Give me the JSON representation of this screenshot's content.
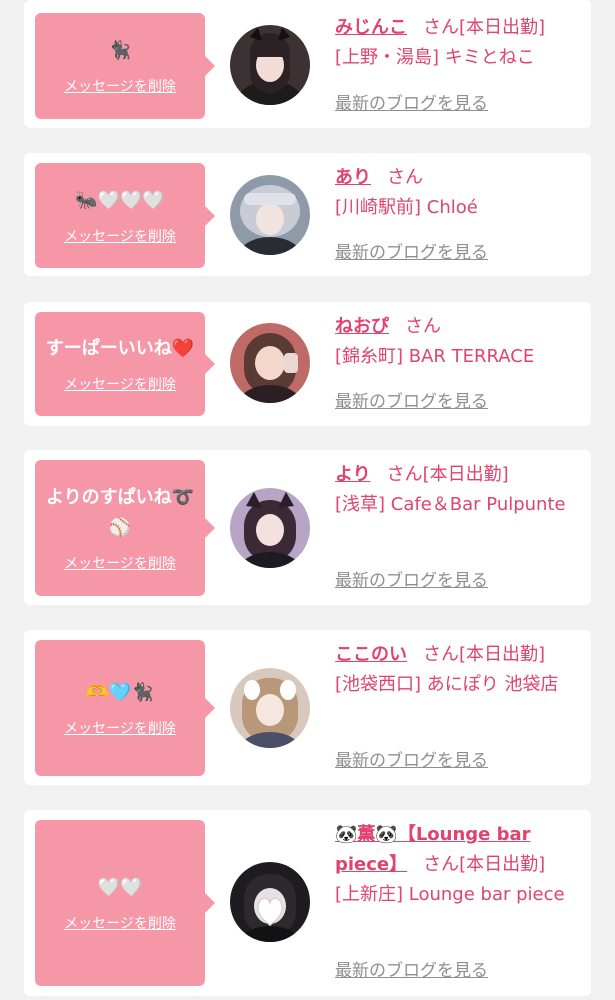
{
  "colors": {
    "accent": "#e0436e",
    "bubble": "#f697a8",
    "link_gray": "#8f8f8f",
    "card_bg": "#ffffff",
    "page_bg": "#f1f1f1"
  },
  "cards": [
    {
      "message": "🐈‍⬛",
      "delete_label": "メッセージを削除",
      "name": "みじんこ",
      "honorific": "さん",
      "status": "[本日出勤]",
      "shop": "[上野・湯島] キミとねこ",
      "blog_link": "最新のブログを見る"
    },
    {
      "message": "🐜🤍🤍🤍",
      "delete_label": "メッセージを削除",
      "name": "あり",
      "honorific": "さん",
      "status": "",
      "shop": "[川崎駅前] Chloé",
      "blog_link": "最新のブログを見る"
    },
    {
      "message": "すーぱーいいね❤️",
      "delete_label": "メッセージを削除",
      "name": "ねおぴ",
      "honorific": "さん",
      "status": "",
      "shop": "[錦糸町] BAR TERRACE",
      "blog_link": "最新のブログを見る"
    },
    {
      "message": "よりのすぱいね➰⚾️",
      "delete_label": "メッセージを削除",
      "name": "より",
      "honorific": "さん",
      "status": "[本日出勤]",
      "shop": "[浅草] Cafe＆Bar Pulpunte",
      "blog_link": "最新のブログを見る"
    },
    {
      "message": "🫶🩵🐈‍⬛",
      "delete_label": "メッセージを削除",
      "name": "ここのい",
      "honorific": "さん",
      "status": "[本日出勤]",
      "shop": "[池袋西口] あにぽり 池袋店",
      "blog_link": "最新のブログを見る"
    },
    {
      "message": "🤍🤍",
      "delete_label": "メッセージを削除",
      "name": "🐼薫🐼【Lounge bar piece】",
      "honorific": "さん",
      "status": "[本日出勤]",
      "shop": "[上新庄] Lounge bar piece",
      "blog_link": "最新のブログを見る"
    }
  ]
}
